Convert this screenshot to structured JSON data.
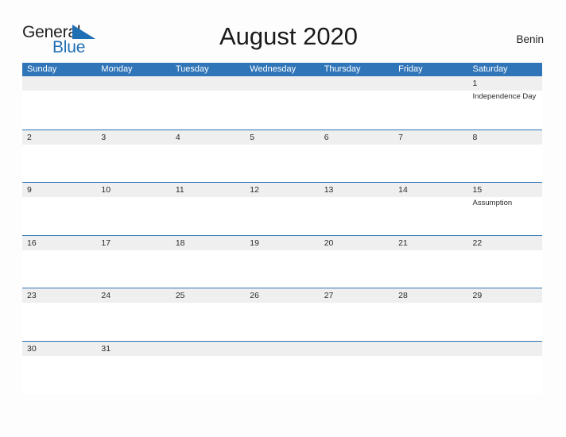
{
  "brand": {
    "word_one": "General",
    "word_two": "Blue",
    "flag_icon": "blue-triangle-flag-icon",
    "color_dark": "#231f20",
    "color_blue": "#1f6fb5"
  },
  "header": {
    "title": "August 2020",
    "month": "August",
    "year": "2020",
    "locale": "Benin"
  },
  "theme": {
    "header_blue": "#3075b8",
    "row_border_blue": "#2e74b5",
    "date_band_gray": "#efefef",
    "page_background": "#fdfdfd",
    "text_dark": "#2b2b2b"
  },
  "weekday_headers": [
    "Sunday",
    "Monday",
    "Tuesday",
    "Wednesday",
    "Thursday",
    "Friday",
    "Saturday"
  ],
  "weeks": [
    [
      {
        "date": ""
      },
      {
        "date": ""
      },
      {
        "date": ""
      },
      {
        "date": ""
      },
      {
        "date": ""
      },
      {
        "date": ""
      },
      {
        "date": "1",
        "holiday": "Independence Day"
      }
    ],
    [
      {
        "date": "2"
      },
      {
        "date": "3"
      },
      {
        "date": "4"
      },
      {
        "date": "5"
      },
      {
        "date": "6"
      },
      {
        "date": "7"
      },
      {
        "date": "8"
      }
    ],
    [
      {
        "date": "9"
      },
      {
        "date": "10"
      },
      {
        "date": "11"
      },
      {
        "date": "12"
      },
      {
        "date": "13"
      },
      {
        "date": "14"
      },
      {
        "date": "15",
        "holiday": "Assumption"
      }
    ],
    [
      {
        "date": "16"
      },
      {
        "date": "17"
      },
      {
        "date": "18"
      },
      {
        "date": "19"
      },
      {
        "date": "20"
      },
      {
        "date": "21"
      },
      {
        "date": "22"
      }
    ],
    [
      {
        "date": "23"
      },
      {
        "date": "24"
      },
      {
        "date": "25"
      },
      {
        "date": "26"
      },
      {
        "date": "27"
      },
      {
        "date": "28"
      },
      {
        "date": "29"
      }
    ],
    [
      {
        "date": "30"
      },
      {
        "date": "31"
      },
      {
        "date": ""
      },
      {
        "date": ""
      },
      {
        "date": ""
      },
      {
        "date": ""
      },
      {
        "date": ""
      }
    ]
  ],
  "holidays": [
    {
      "date": "1",
      "name": "Independence Day",
      "weekday": "Saturday"
    },
    {
      "date": "15",
      "name": "Assumption",
      "weekday": "Saturday"
    }
  ]
}
